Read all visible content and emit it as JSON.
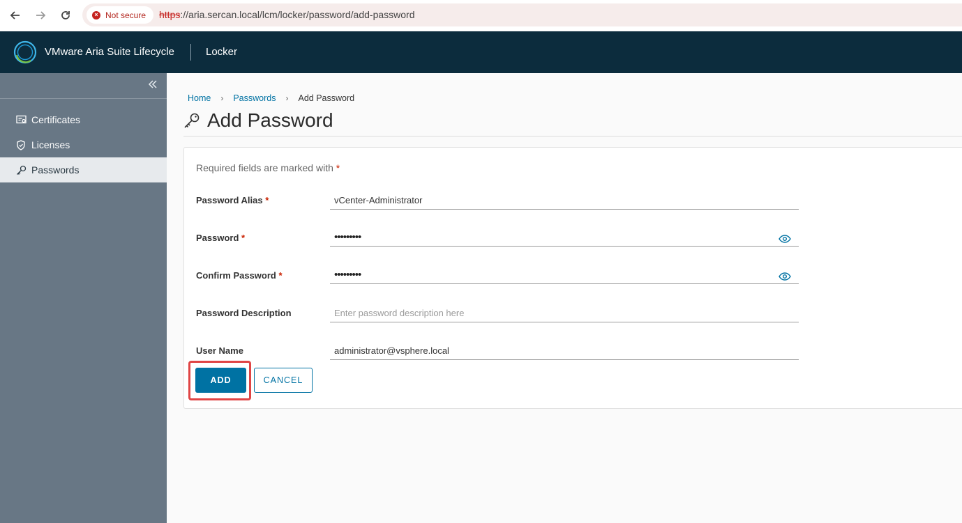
{
  "browser": {
    "security_label": "Not secure",
    "url_scheme": "https",
    "url_rest": "://aria.sercan.local/lcm/locker/password/add-password"
  },
  "header": {
    "app_title": "VMware Aria Suite Lifecycle",
    "section": "Locker"
  },
  "sidebar": {
    "items": [
      {
        "label": "Certificates",
        "icon": "certificate-icon"
      },
      {
        "label": "Licenses",
        "icon": "shield-icon"
      },
      {
        "label": "Passwords",
        "icon": "key-icon",
        "active": true
      }
    ]
  },
  "breadcrumb": {
    "items": [
      "Home",
      "Passwords",
      "Add Password"
    ],
    "separator": "›"
  },
  "page": {
    "title": "Add Password"
  },
  "form": {
    "required_note": "Required fields are marked with",
    "required_mark": "*",
    "fields": {
      "alias": {
        "label": "Password Alias",
        "value": "vCenter-Administrator"
      },
      "password": {
        "label": "Password",
        "value": "•••••••••"
      },
      "confirm": {
        "label": "Confirm Password",
        "value": "•••••••••"
      },
      "description": {
        "label": "Password Description",
        "value": "",
        "placeholder": "Enter password description here"
      },
      "username": {
        "label": "User Name",
        "value": "administrator@vsphere.local"
      }
    },
    "add_label": "ADD",
    "cancel_label": "CANCEL"
  },
  "colors": {
    "header_bg": "#0c2c3d",
    "sidebar_bg": "#687785",
    "accent": "#0072a3",
    "required": "#c92100",
    "highlight": "#e04545"
  }
}
